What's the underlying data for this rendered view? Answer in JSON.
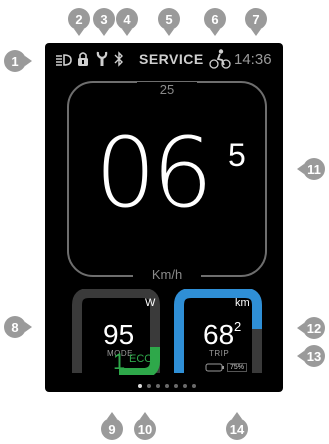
{
  "status_bar": {
    "service_label": "SERVICE",
    "time": "14:36"
  },
  "speedometer": {
    "max_speed": "25",
    "speed_integer": "06",
    "speed_decimal": "5",
    "unit": "Km/h"
  },
  "power_tile": {
    "unit": "W",
    "value": "95",
    "caption": "MODE",
    "mode_number": "1",
    "mode_name": "ECO",
    "accent_color": "#2ea84a"
  },
  "trip_tile": {
    "unit": "km",
    "value_integer": "68",
    "value_decimal": "2",
    "caption": "TRIP",
    "battery_percent": "75%",
    "accent_color": "#2f8fd6"
  },
  "page_indicator": {
    "total": 7,
    "active": 0
  },
  "callouts": [
    "1",
    "2",
    "3",
    "4",
    "5",
    "6",
    "7",
    "8",
    "9",
    "10",
    "11",
    "12",
    "13",
    "14"
  ],
  "icons": {
    "headlight": "headlight-icon",
    "lock": "lock-icon",
    "wrench": "wrench-icon",
    "bluetooth": "bluetooth-icon",
    "bike_assist": "walk-assist-icon"
  }
}
